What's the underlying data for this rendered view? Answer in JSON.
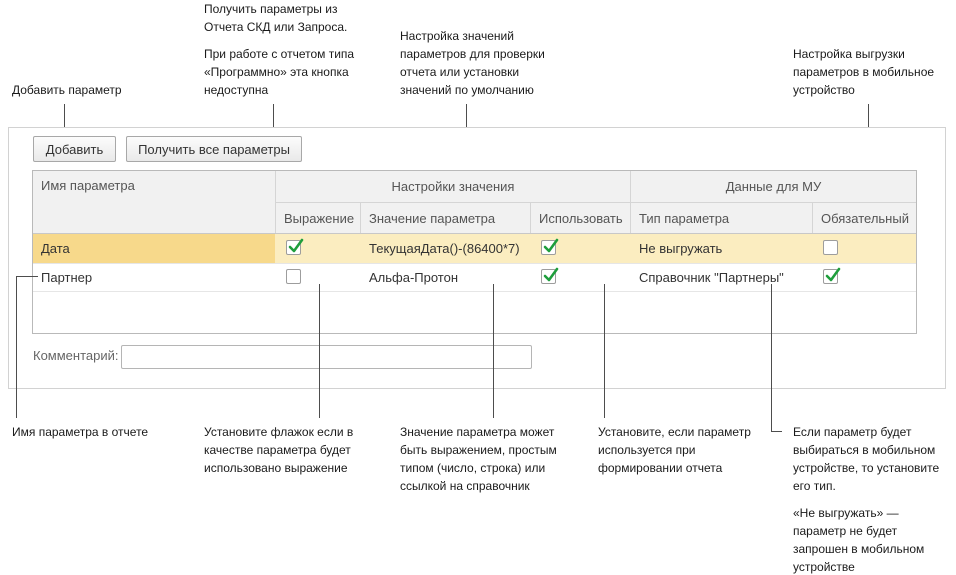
{
  "annotations": {
    "add_param": "Добавить параметр",
    "get_params": [
      "Получить параметры из Отчета СКД или Запроса.",
      "При работе с отчетом типа «Программно» эта кнопка недоступна"
    ],
    "value_settings": "Настройка значений параметров для проверки отчета или установки значений по умолчанию",
    "mobile_export": "Настройка выгрузки параметров в мобильное устройство",
    "param_name": "Имя параметра в отчете",
    "expression_flag": "Установите флажок если в качестве параметра будет использовано выражение",
    "param_value": "Значение параметра может быть выражением, простым типом (число, строка) или ссылкой на справочник",
    "use_flag": "Установите, если параметр используется при формировании отчета",
    "mobile_type": [
      "Если параметр будет выбираться в мобильном устройстве, то установите его тип.",
      "«Не выгружать» — параметр не будет запрошен в мобильном устройстве"
    ]
  },
  "toolbar": {
    "add_label": "Добавить",
    "get_all_label": "Получить все параметры"
  },
  "table": {
    "headers": {
      "name": "Имя параметра",
      "value_settings": "Настройки значения",
      "mobile_data": "Данные для МУ",
      "expression": "Выражение",
      "param_value": "Значение параметра",
      "use": "Использовать",
      "param_type": "Тип параметра",
      "required": "Обязательный"
    },
    "rows": [
      {
        "name": "Дата",
        "expression": true,
        "value": "ТекущаяДата()-(86400*7)",
        "use": true,
        "type": "Не выгружать",
        "required": false,
        "selected": true
      },
      {
        "name": "Партнер",
        "expression": false,
        "value": "Альфа-Протон",
        "use": true,
        "type": "Справочник \"Партнеры\"",
        "required": true,
        "selected": false
      }
    ]
  },
  "comment": {
    "label": "Комментарий:",
    "value": ""
  },
  "colors": {
    "check_mark": "#1e9e3c",
    "selected_row": "#fbedc0",
    "selected_cell": "#f7d98b",
    "header_bg": "#f1f1f1"
  }
}
